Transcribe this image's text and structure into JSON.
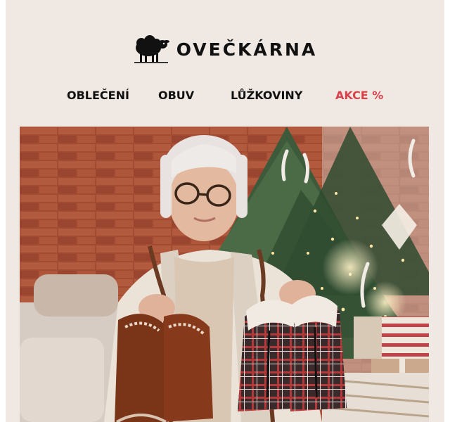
{
  "brand": {
    "name": "OVEČKÁRNA"
  },
  "nav": {
    "items": [
      {
        "label": "OBLEČENÍ"
      },
      {
        "label": "OBUV"
      },
      {
        "label": "LŮŽKOVINY"
      },
      {
        "label": "AKCE %"
      }
    ],
    "sale_color": "#d9424b"
  },
  "hero": {
    "icon": "hero-photo"
  }
}
